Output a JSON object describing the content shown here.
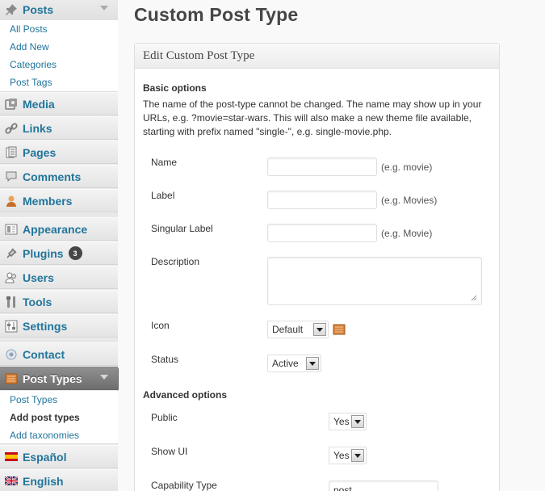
{
  "sidebar": {
    "posts": {
      "label": "Posts",
      "items": [
        "All Posts",
        "Add New",
        "Categories",
        "Post Tags"
      ]
    },
    "menu": {
      "media": "Media",
      "links": "Links",
      "pages": "Pages",
      "comments": "Comments",
      "members": "Members",
      "appearance": "Appearance",
      "plugins": "Plugins",
      "plugins_badge": "3",
      "users": "Users",
      "tools": "Tools",
      "settings": "Settings",
      "contact": "Contact",
      "post_types": "Post Types",
      "espanol": "Español",
      "english": "English"
    },
    "post_types_items": [
      "Post Types",
      "Add post types",
      "Add taxonomies"
    ]
  },
  "page": {
    "title": "Custom Post Type",
    "box_title": "Edit Custom Post Type",
    "basic_title": "Basic options",
    "intro": "The name of the post-type cannot be changed. The name may show up in your URLs, e.g. ?movie=star-wars. This will also make a new theme file available, starting with prefix named \"single-\", e.g. single-movie.php.",
    "fields": {
      "name_label": "Name",
      "name_value": "",
      "name_hint": "(e.g. movie)",
      "label_label": "Label",
      "label_value": "",
      "label_hint": "(e.g. Movies)",
      "singular_label": "Singular Label",
      "singular_value": "",
      "singular_hint": "(e.g. Movie)",
      "description_label": "Description",
      "description_value": "",
      "icon_label": "Icon",
      "icon_value": "Default",
      "status_label": "Status",
      "status_value": "Active"
    },
    "advanced_title": "Advanced options",
    "advanced": {
      "public_label": "Public",
      "public_value": "Yes",
      "showui_label": "Show UI",
      "showui_value": "Yes",
      "capability_label": "Capability Type",
      "capability_value": "post"
    }
  },
  "colors": {
    "link": "#21759b",
    "active_menu": "#6e6e6e",
    "icon_box": "#c77a2d"
  }
}
